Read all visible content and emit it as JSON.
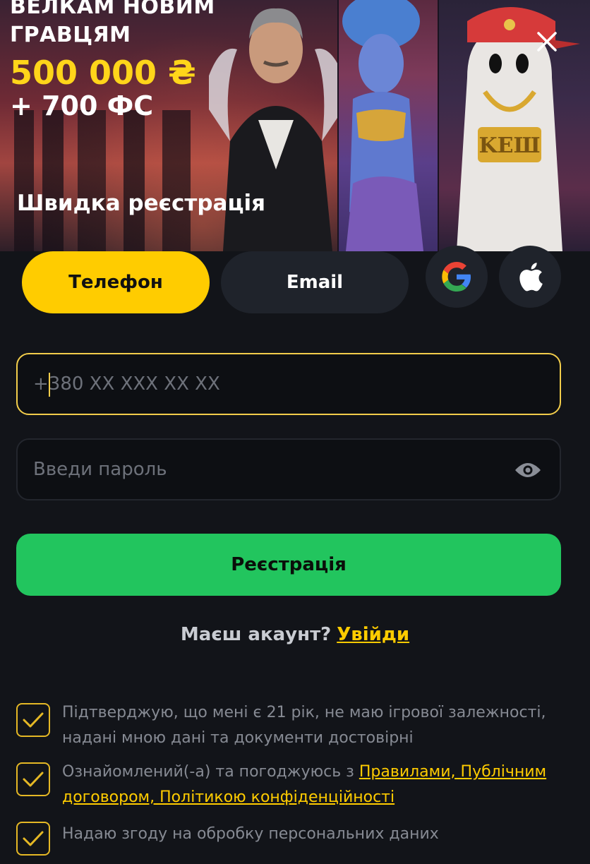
{
  "banner": {
    "promo_line1": "ВЕЛКАМ НОВИМ",
    "promo_line2": "ГРАВЦЯМ",
    "promo_amount": "500 000 ₴",
    "promo_spins": "+ 700 ФС",
    "title": "Швидка реєстрація",
    "hat_text": "KEШ"
  },
  "close": {
    "icon": "close-icon"
  },
  "tabs": {
    "phone_label": "Телефон",
    "email_label": "Email",
    "active": "phone"
  },
  "social": [
    {
      "name": "google-icon"
    },
    {
      "name": "apple-icon"
    }
  ],
  "form": {
    "phone_placeholder": "+380 XX XXX XX XX",
    "password_placeholder": "Введи пароль",
    "register_label": "Реєстрація"
  },
  "login": {
    "prompt": "Маєш акаунт?",
    "link": "Увійди"
  },
  "consents": {
    "age": "Підтверджую, що мені є 21 рік, не маю ігрової залежності, надані мною дані та документи достовірні",
    "terms_prefix": "Ознайомлений(-а) та погоджуюсь з ",
    "terms_link": "Правилами, Публічним договором, Політикою конфіденційності",
    "personal_data": "Надаю згоду на обробку персональних даних"
  },
  "colors": {
    "accent": "#ffcc00",
    "primary_button": "#22c55e",
    "background": "#121419",
    "surface": "#1f232b"
  }
}
